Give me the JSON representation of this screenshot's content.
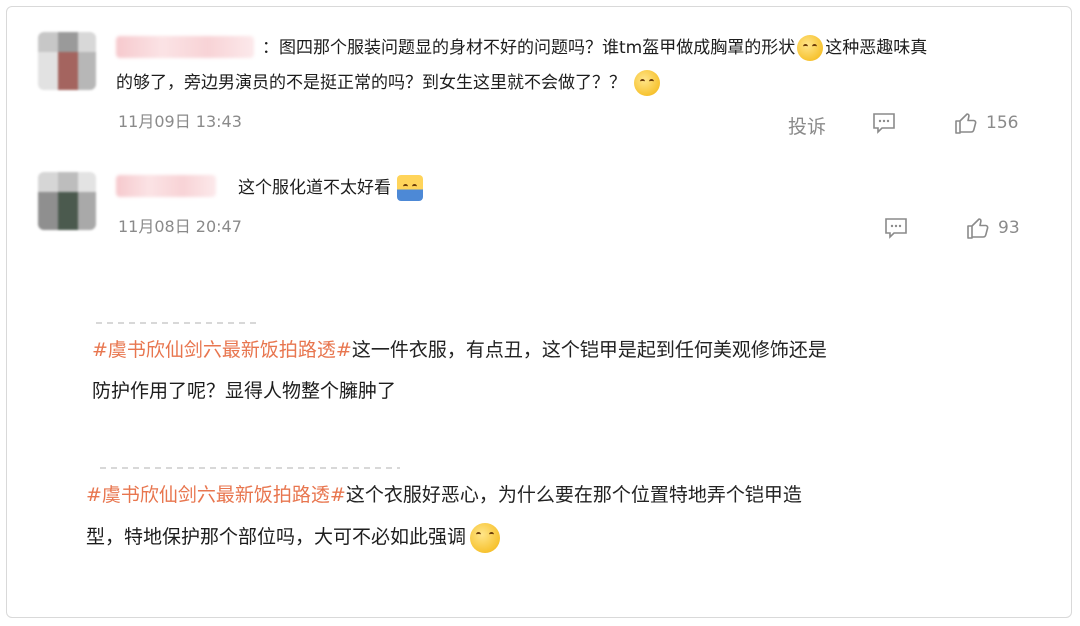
{
  "comments": [
    {
      "text_line1": "：图四那个服装问题显的身材不好的问题吗？谁tm盔甲做成胸罩的形状",
      "text_line1_tail": "这种恶趣味真",
      "text_line2": "的够了，旁边男演员的不是挺正常的吗？到女生这里就不会做了？？",
      "date": "11月09日 13:43",
      "report_label": "投诉",
      "likes": "156",
      "emoji": [
        "grimace-emoji",
        "smile-emoji"
      ]
    },
    {
      "text_line1": "这个服化道不太好看",
      "date": "11月08日 20:47",
      "likes": "93",
      "emoji": [
        "facepalm-emoji"
      ]
    }
  ],
  "posts": [
    {
      "hashtag": "#虞书欣仙剑六最新饭拍路透#",
      "text_line1": "这一件衣服，有点丑，这个铠甲是起到任何美观修饰还是",
      "text_line2": "防护作用了呢？显得人物整个臃肿了"
    },
    {
      "hashtag": "#虞书欣仙剑六最新饭拍路透#",
      "text_line1": "这个衣服好恶心，为什么要在那个位置特地弄个铠甲造",
      "text_line2": "型，特地保护那个部位吗，大可不必如此强调",
      "emoji": [
        "wink-emoji"
      ]
    }
  ],
  "colors": {
    "hashtag": "#e8764f",
    "meta_gray": "#8a8a8a"
  }
}
